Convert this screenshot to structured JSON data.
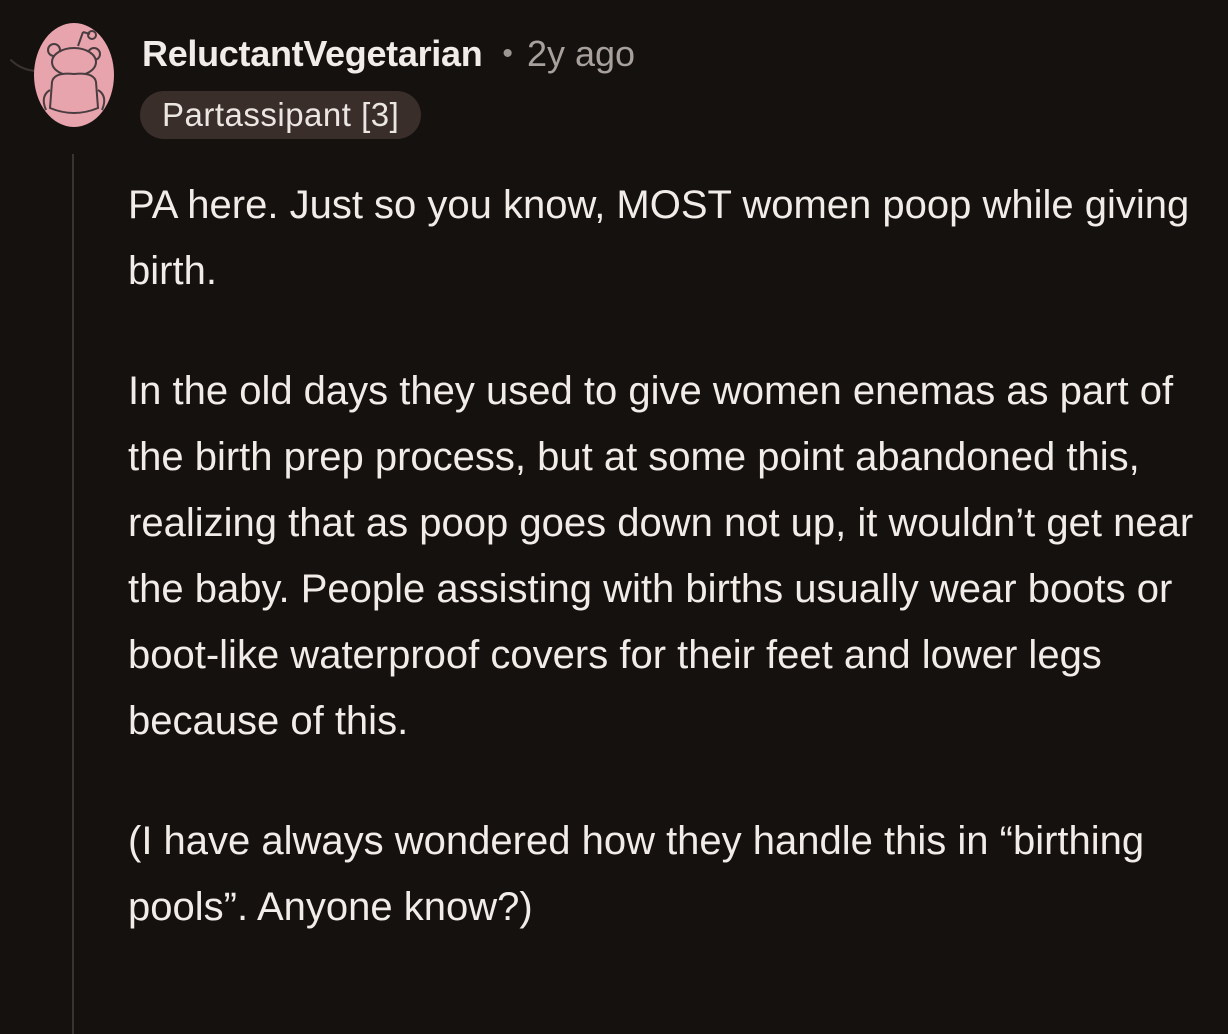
{
  "comment": {
    "author": "ReluctantVegetarian",
    "separator": "•",
    "timestamp": "2y ago",
    "flair": "Partassipant [3]",
    "paragraphs": [
      "PA here. Just so you know, MOST women poop while giving birth.",
      "In the old days they used to give women enemas as part of the birth prep process, but at some point abandoned this, realizing that as poop goes down not up, it wouldn’t get near the baby. People assisting with births usually wear boots or boot-like waterproof covers for their feet and lower legs because of this.",
      "(I have always wondered how they handle this in “birthing pools”. Anyone know?)"
    ]
  },
  "avatar": {
    "icon": "snoo-avatar-icon",
    "background_color": "#e8a4ad"
  },
  "colors": {
    "background": "#15110f",
    "text": "#f1ece8",
    "muted": "#a7a09c",
    "flair_bg": "#3a2e2a"
  }
}
